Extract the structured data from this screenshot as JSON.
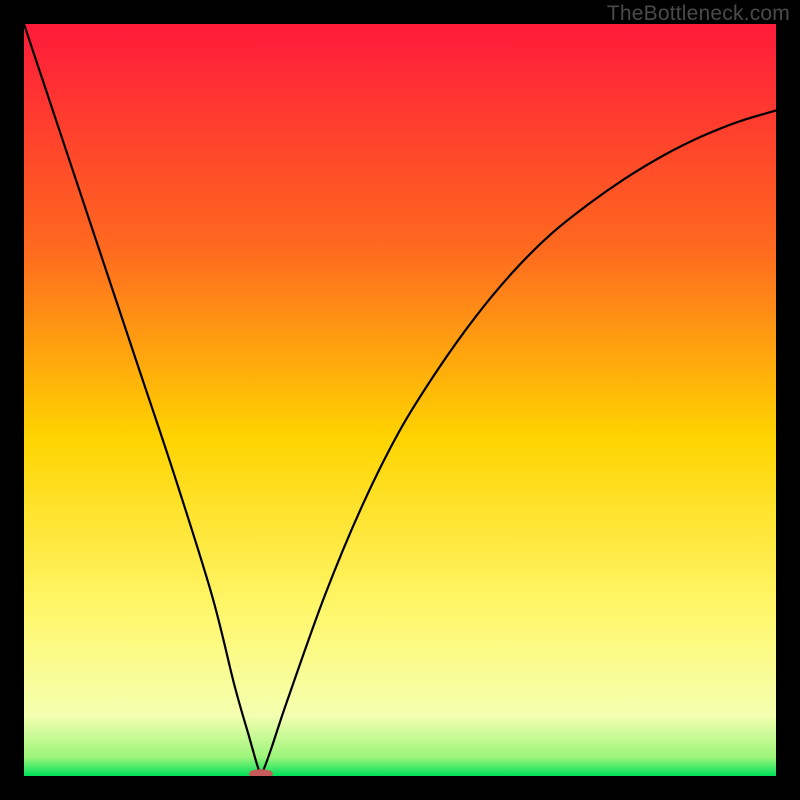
{
  "watermark": "TheBottleneck.com",
  "chart_data": {
    "type": "line",
    "title": "",
    "xlabel": "",
    "ylabel": "",
    "xlim": [
      0,
      100
    ],
    "ylim": [
      0,
      100
    ],
    "grid": false,
    "legend": false,
    "annotations": [],
    "background_gradient": {
      "top": "#ff1a3a",
      "mid_upper": "#ff8a1f",
      "mid": "#ffd400",
      "mid_lower": "#fff76b",
      "lower_band": "#f7ffb0",
      "bottom": "#00e05a"
    },
    "series": [
      {
        "name": "curve",
        "x": [
          0,
          5,
          10,
          15,
          20,
          25,
          28,
          30,
          31,
          31.5,
          32,
          33,
          35,
          40,
          45,
          50,
          55,
          60,
          65,
          70,
          75,
          80,
          85,
          90,
          95,
          100
        ],
        "y": [
          100,
          85,
          70,
          55,
          40,
          24,
          12,
          5,
          1.5,
          0.3,
          1.2,
          4,
          10,
          24,
          36,
          46,
          54,
          61,
          67,
          72,
          76,
          79.5,
          82.5,
          85,
          87,
          88.5
        ]
      }
    ],
    "marker": {
      "name": "min-marker",
      "x": 31.5,
      "y": 0.3,
      "rx": 1.6,
      "ry": 0.6,
      "color": "#c75a5a"
    }
  }
}
